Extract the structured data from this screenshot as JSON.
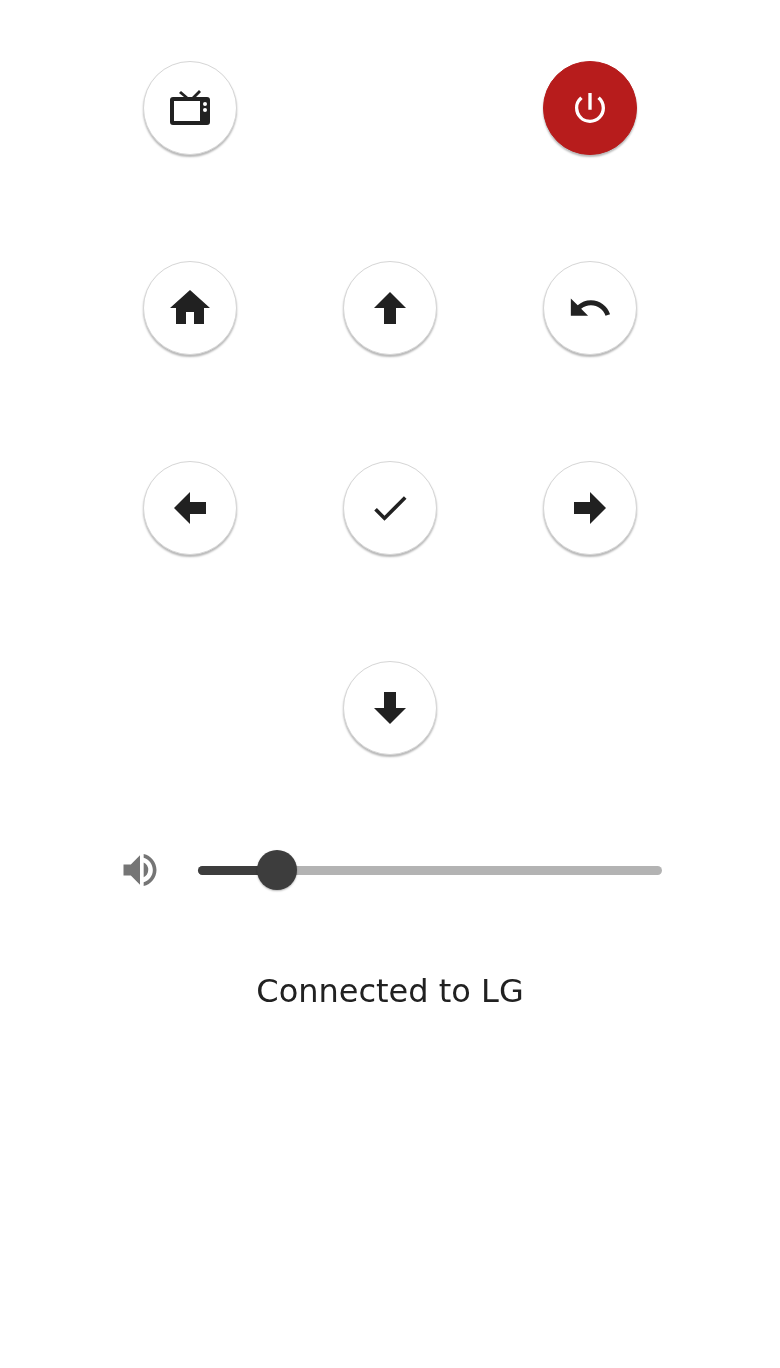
{
  "rows": [
    {
      "buttons": [
        {
          "kind": "tv"
        },
        {
          "kind": "empty"
        },
        {
          "kind": "power"
        }
      ]
    },
    {
      "buttons": [
        {
          "kind": "home"
        },
        {
          "kind": "up"
        },
        {
          "kind": "back"
        }
      ]
    },
    {
      "buttons": [
        {
          "kind": "left"
        },
        {
          "kind": "ok"
        },
        {
          "kind": "right"
        }
      ]
    },
    {
      "buttons": [
        {
          "kind": "empty"
        },
        {
          "kind": "down"
        },
        {
          "kind": "empty"
        }
      ]
    }
  ],
  "volume": {
    "level": 0.17
  },
  "status": "Connected to LG"
}
